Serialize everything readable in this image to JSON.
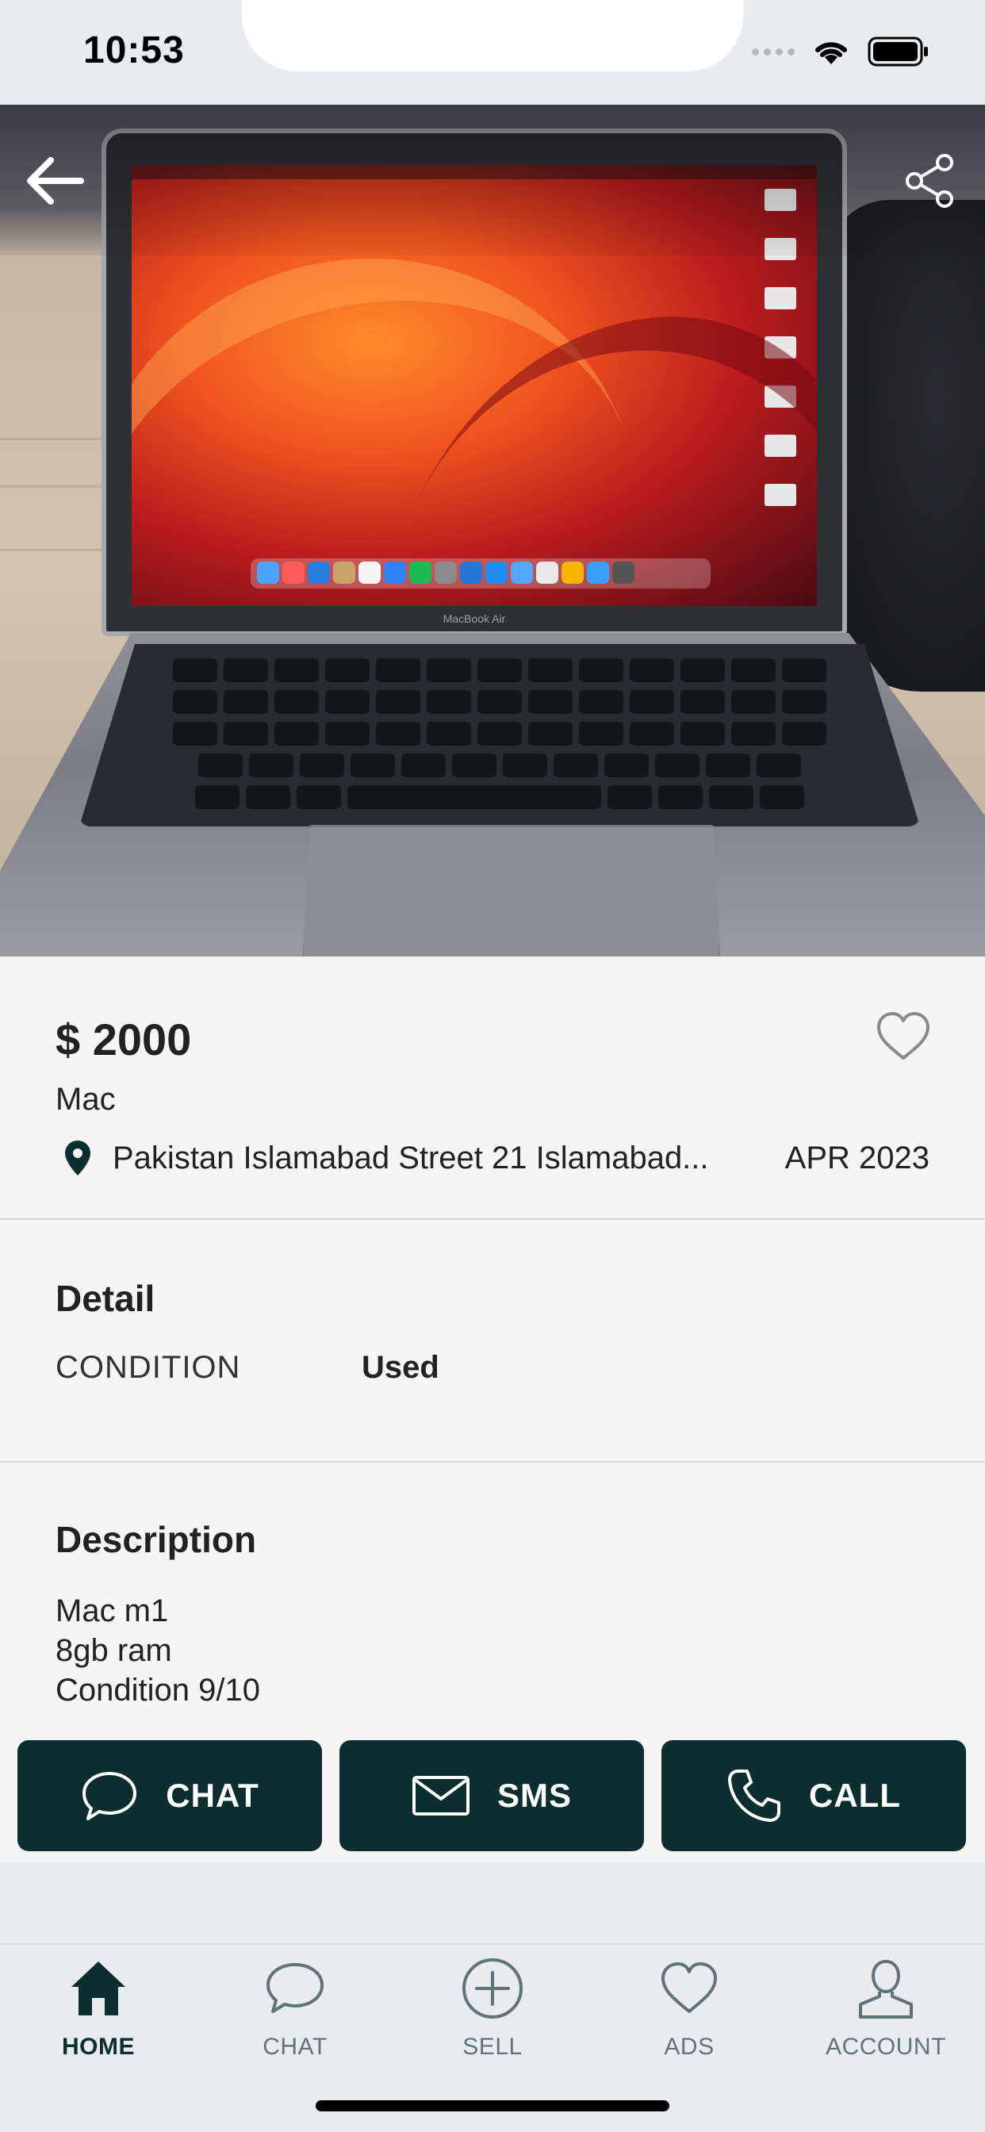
{
  "status_bar": {
    "time": "10:53"
  },
  "listing": {
    "price": "$ 2000",
    "title": "Mac",
    "location": "Pakistan Islamabad  Street 21 Islamabad...",
    "date": "APR 2023",
    "detail_heading": "Detail",
    "condition_label": "CONDITION",
    "condition_value": "Used",
    "description_heading": "Description",
    "description_lines": [
      "Mac m1",
      "8gb ram",
      "Condition 9/10"
    ]
  },
  "actions": {
    "chat_label": "CHAT",
    "sms_label": "SMS",
    "call_label": "CALL",
    "color": "#0c2e31"
  },
  "bottom_nav": {
    "items": [
      {
        "label": "HOME",
        "icon": "home-icon",
        "active": true
      },
      {
        "label": "CHAT",
        "icon": "chat-icon",
        "active": false
      },
      {
        "label": "SELL",
        "icon": "plus-circle-icon",
        "active": false
      },
      {
        "label": "ADS",
        "icon": "heart-icon",
        "active": false
      },
      {
        "label": "ACCOUNT",
        "icon": "user-icon",
        "active": false
      }
    ]
  },
  "hero": {
    "image_subject": "laptop-photo",
    "laptop_label": "MacBook Air"
  }
}
